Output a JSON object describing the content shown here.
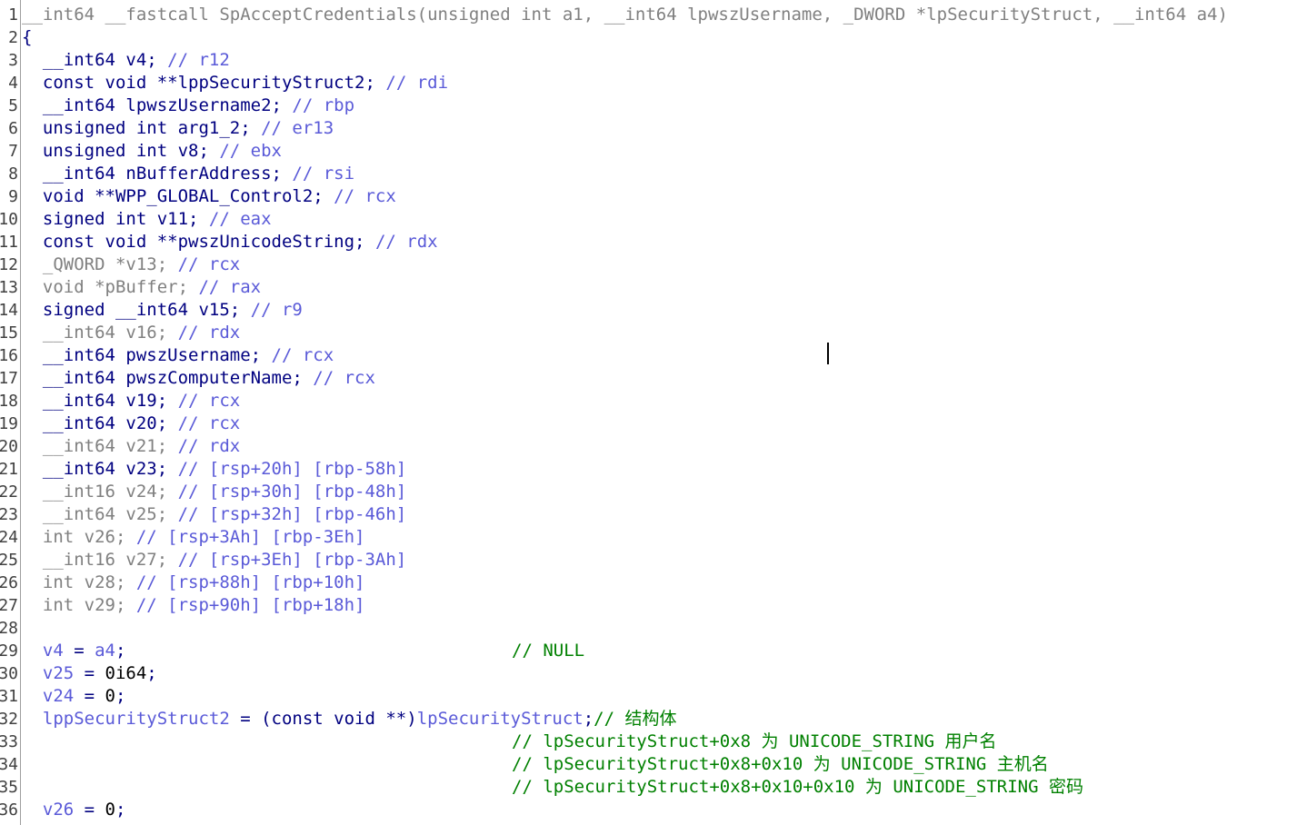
{
  "gutter": {
    "line_numbers": [
      "1",
      "2",
      "3",
      "4",
      "5",
      "6",
      "7",
      "8",
      "9",
      "10",
      "11",
      "12",
      "13",
      "14",
      "15",
      "16",
      "17",
      "18",
      "19",
      "20",
      "21",
      "22",
      "23",
      "24",
      "25",
      "26",
      "27",
      "28",
      "29",
      "30",
      "31",
      "32",
      "33",
      "34",
      "35",
      "36"
    ]
  },
  "code": {
    "lines": [
      {
        "segments": [
          {
            "t": "__int64 __fastcall SpAcceptCredentials(unsigned int a1, __int64 lpwszUsername, _DWORD *lpSecurityStruct, __int64 a4)",
            "c": "gray"
          }
        ]
      },
      {
        "segments": [
          {
            "t": "{",
            "c": "navy"
          }
        ]
      },
      {
        "segments": [
          {
            "t": "  __int64 v4; ",
            "c": "navy"
          },
          {
            "t": "// r12",
            "c": "blue"
          }
        ]
      },
      {
        "segments": [
          {
            "t": "  const void **lppSecurityStruct2; ",
            "c": "navy"
          },
          {
            "t": "// rdi",
            "c": "blue"
          }
        ]
      },
      {
        "segments": [
          {
            "t": "  __int64 lpwszUsername2; ",
            "c": "navy"
          },
          {
            "t": "// rbp",
            "c": "blue"
          }
        ]
      },
      {
        "segments": [
          {
            "t": "  unsigned int arg1_2; ",
            "c": "navy"
          },
          {
            "t": "// er13",
            "c": "blue"
          }
        ]
      },
      {
        "segments": [
          {
            "t": "  unsigned int v8; ",
            "c": "navy"
          },
          {
            "t": "// ebx",
            "c": "blue"
          }
        ]
      },
      {
        "segments": [
          {
            "t": "  __int64 nBufferAddress; ",
            "c": "navy"
          },
          {
            "t": "// rsi",
            "c": "blue"
          }
        ]
      },
      {
        "segments": [
          {
            "t": "  void **WPP_GLOBAL_Control2; ",
            "c": "navy"
          },
          {
            "t": "// rcx",
            "c": "blue"
          }
        ]
      },
      {
        "segments": [
          {
            "t": "  signed int v11; ",
            "c": "navy"
          },
          {
            "t": "// eax",
            "c": "blue"
          }
        ]
      },
      {
        "segments": [
          {
            "t": "  const void **pwszUnicodeString; ",
            "c": "navy"
          },
          {
            "t": "// rdx",
            "c": "blue"
          }
        ]
      },
      {
        "segments": [
          {
            "t": "  _QWORD *v13; ",
            "c": "gray"
          },
          {
            "t": "// rcx",
            "c": "blue"
          }
        ]
      },
      {
        "segments": [
          {
            "t": "  void *pBuffer; ",
            "c": "gray"
          },
          {
            "t": "// rax",
            "c": "blue"
          }
        ]
      },
      {
        "segments": [
          {
            "t": "  signed __int64 v15; ",
            "c": "navy"
          },
          {
            "t": "// r9",
            "c": "blue"
          }
        ]
      },
      {
        "segments": [
          {
            "t": "  __int64 v16; ",
            "c": "gray"
          },
          {
            "t": "// rdx",
            "c": "blue"
          }
        ]
      },
      {
        "segments": [
          {
            "t": "  __int64 pwszUsername; ",
            "c": "navy"
          },
          {
            "t": "// rcx",
            "c": "blue"
          }
        ]
      },
      {
        "segments": [
          {
            "t": "  __int64 pwszComputerName; ",
            "c": "navy"
          },
          {
            "t": "// rcx",
            "c": "blue"
          }
        ]
      },
      {
        "segments": [
          {
            "t": "  __int64 v19; ",
            "c": "navy"
          },
          {
            "t": "// rcx",
            "c": "blue"
          }
        ]
      },
      {
        "segments": [
          {
            "t": "  __int64 v20; ",
            "c": "navy"
          },
          {
            "t": "// rcx",
            "c": "blue"
          }
        ]
      },
      {
        "segments": [
          {
            "t": "  __int64 v21; ",
            "c": "gray"
          },
          {
            "t": "// rdx",
            "c": "blue"
          }
        ]
      },
      {
        "segments": [
          {
            "t": "  __int64 v23; ",
            "c": "navy"
          },
          {
            "t": "// [rsp+20h] [rbp-58h]",
            "c": "blue"
          }
        ]
      },
      {
        "segments": [
          {
            "t": "  __int16 v24; ",
            "c": "gray"
          },
          {
            "t": "// [rsp+30h] [rbp-48h]",
            "c": "blue"
          }
        ]
      },
      {
        "segments": [
          {
            "t": "  __int64 v25; ",
            "c": "gray"
          },
          {
            "t": "// [rsp+32h] [rbp-46h]",
            "c": "blue"
          }
        ]
      },
      {
        "segments": [
          {
            "t": "  int v26; ",
            "c": "gray"
          },
          {
            "t": "// [rsp+3Ah] [rbp-3Eh]",
            "c": "blue"
          }
        ]
      },
      {
        "segments": [
          {
            "t": "  __int16 v27; ",
            "c": "gray"
          },
          {
            "t": "// [rsp+3Eh] [rbp-3Ah]",
            "c": "blue"
          }
        ]
      },
      {
        "segments": [
          {
            "t": "  int v28; ",
            "c": "gray"
          },
          {
            "t": "// [rsp+88h] [rbp+10h]",
            "c": "blue"
          }
        ]
      },
      {
        "segments": [
          {
            "t": "  int v29; ",
            "c": "gray"
          },
          {
            "t": "// [rsp+90h] [rbp+18h]",
            "c": "blue"
          }
        ]
      },
      {
        "segments": []
      },
      {
        "segments": [
          {
            "t": "  v4",
            "c": "blue"
          },
          {
            "t": " = ",
            "c": "navy"
          },
          {
            "t": "a4",
            "c": "blue"
          },
          {
            "t": ";",
            "c": "navy"
          }
        ],
        "comment": "// NULL"
      },
      {
        "segments": [
          {
            "t": "  v25",
            "c": "blue"
          },
          {
            "t": " = ",
            "c": "navy"
          },
          {
            "t": "0i64",
            "c": "black"
          },
          {
            "t": ";",
            "c": "navy"
          }
        ]
      },
      {
        "segments": [
          {
            "t": "  v24",
            "c": "blue"
          },
          {
            "t": " = ",
            "c": "navy"
          },
          {
            "t": "0",
            "c": "black"
          },
          {
            "t": ";",
            "c": "navy"
          }
        ]
      },
      {
        "segments": [
          {
            "t": "  lppSecurityStruct2",
            "c": "blue"
          },
          {
            "t": " = (const void **)",
            "c": "navy"
          },
          {
            "t": "lpSecurityStruct",
            "c": "blue"
          },
          {
            "t": ";",
            "c": "navy"
          },
          {
            "t": "// 结构体",
            "c": "green"
          }
        ]
      },
      {
        "segments": [],
        "comment": "// lpSecurityStruct+0x8 为 UNICODE_STRING 用户名"
      },
      {
        "segments": [],
        "comment": "// lpSecurityStruct+0x8+0x10 为 UNICODE_STRING 主机名"
      },
      {
        "segments": [],
        "comment": "// lpSecurityStruct+0x8+0x10+0x10 为 UNICODE_STRING 密码"
      },
      {
        "segments": [
          {
            "t": "  v26",
            "c": "blue"
          },
          {
            "t": " = ",
            "c": "navy"
          },
          {
            "t": "0",
            "c": "black"
          },
          {
            "t": ";",
            "c": "navy"
          }
        ]
      }
    ]
  },
  "colors": {
    "keyword_dark": "#000080",
    "inactive_gray": "#808080",
    "variable_blue": "#5a5ad8",
    "comment_green": "#008000",
    "gutter_border": "#9e9e9e"
  }
}
